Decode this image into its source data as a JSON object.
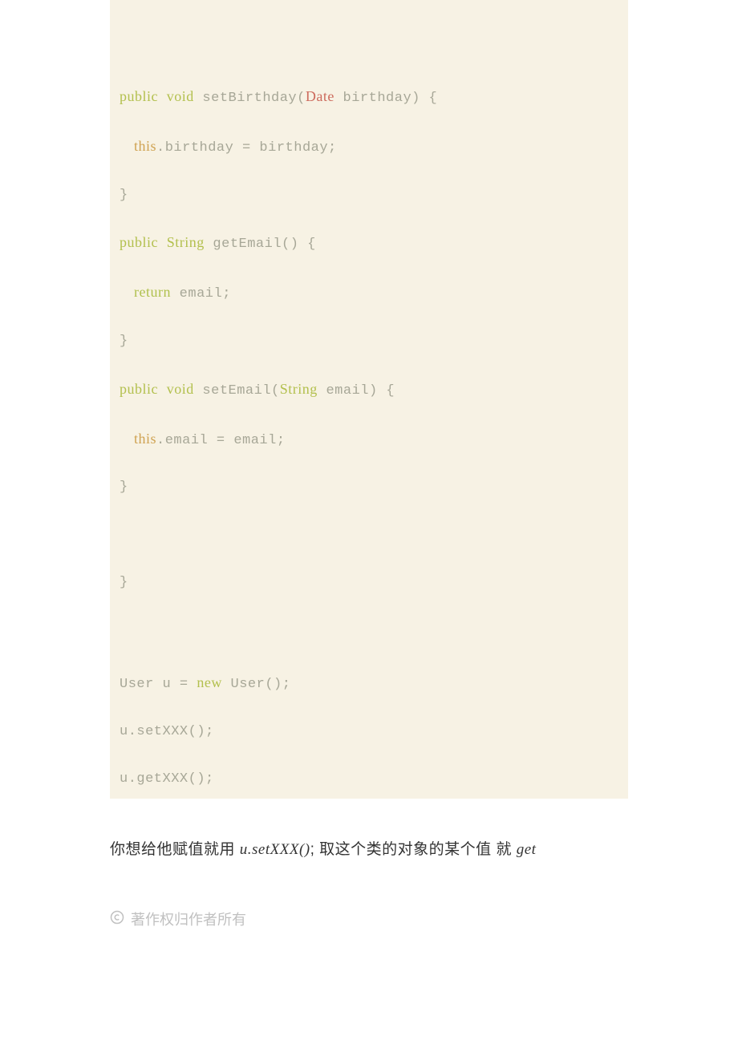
{
  "code": {
    "l1_public": "public",
    "l1_void": "void",
    "l1_fn": " setBirthday(",
    "l1_type": "Date",
    "l1_tail": " birthday) {",
    "l2_this": "this",
    "l2_tail": ".birthday = birthday;",
    "l3": "}",
    "l4_public": "public",
    "l4_type": "String",
    "l4_tail": " getEmail() {",
    "l5_return": "return",
    "l5_tail": " email;",
    "l6": "}",
    "l7_public": "public",
    "l7_void": "void",
    "l7_fn": " setEmail(",
    "l7_type": "String",
    "l7_tail": " email) {",
    "l8_this": "this",
    "l8_tail": ".email = email;",
    "l9": "}",
    "l10": "}",
    "l11_head": "User u = ",
    "l11_new": "new",
    "l11_tail": " User();",
    "l12": "u.setXXX();",
    "l13": "u.getXXX();"
  },
  "explain": {
    "p1": "你想给他赋值就用 ",
    "p1_italic": "u.setXXX()",
    "p1_semi": ";      取这个类的对象的某个值 就 ",
    "p1_get": "get"
  },
  "copyright": "著作权归作者所有"
}
